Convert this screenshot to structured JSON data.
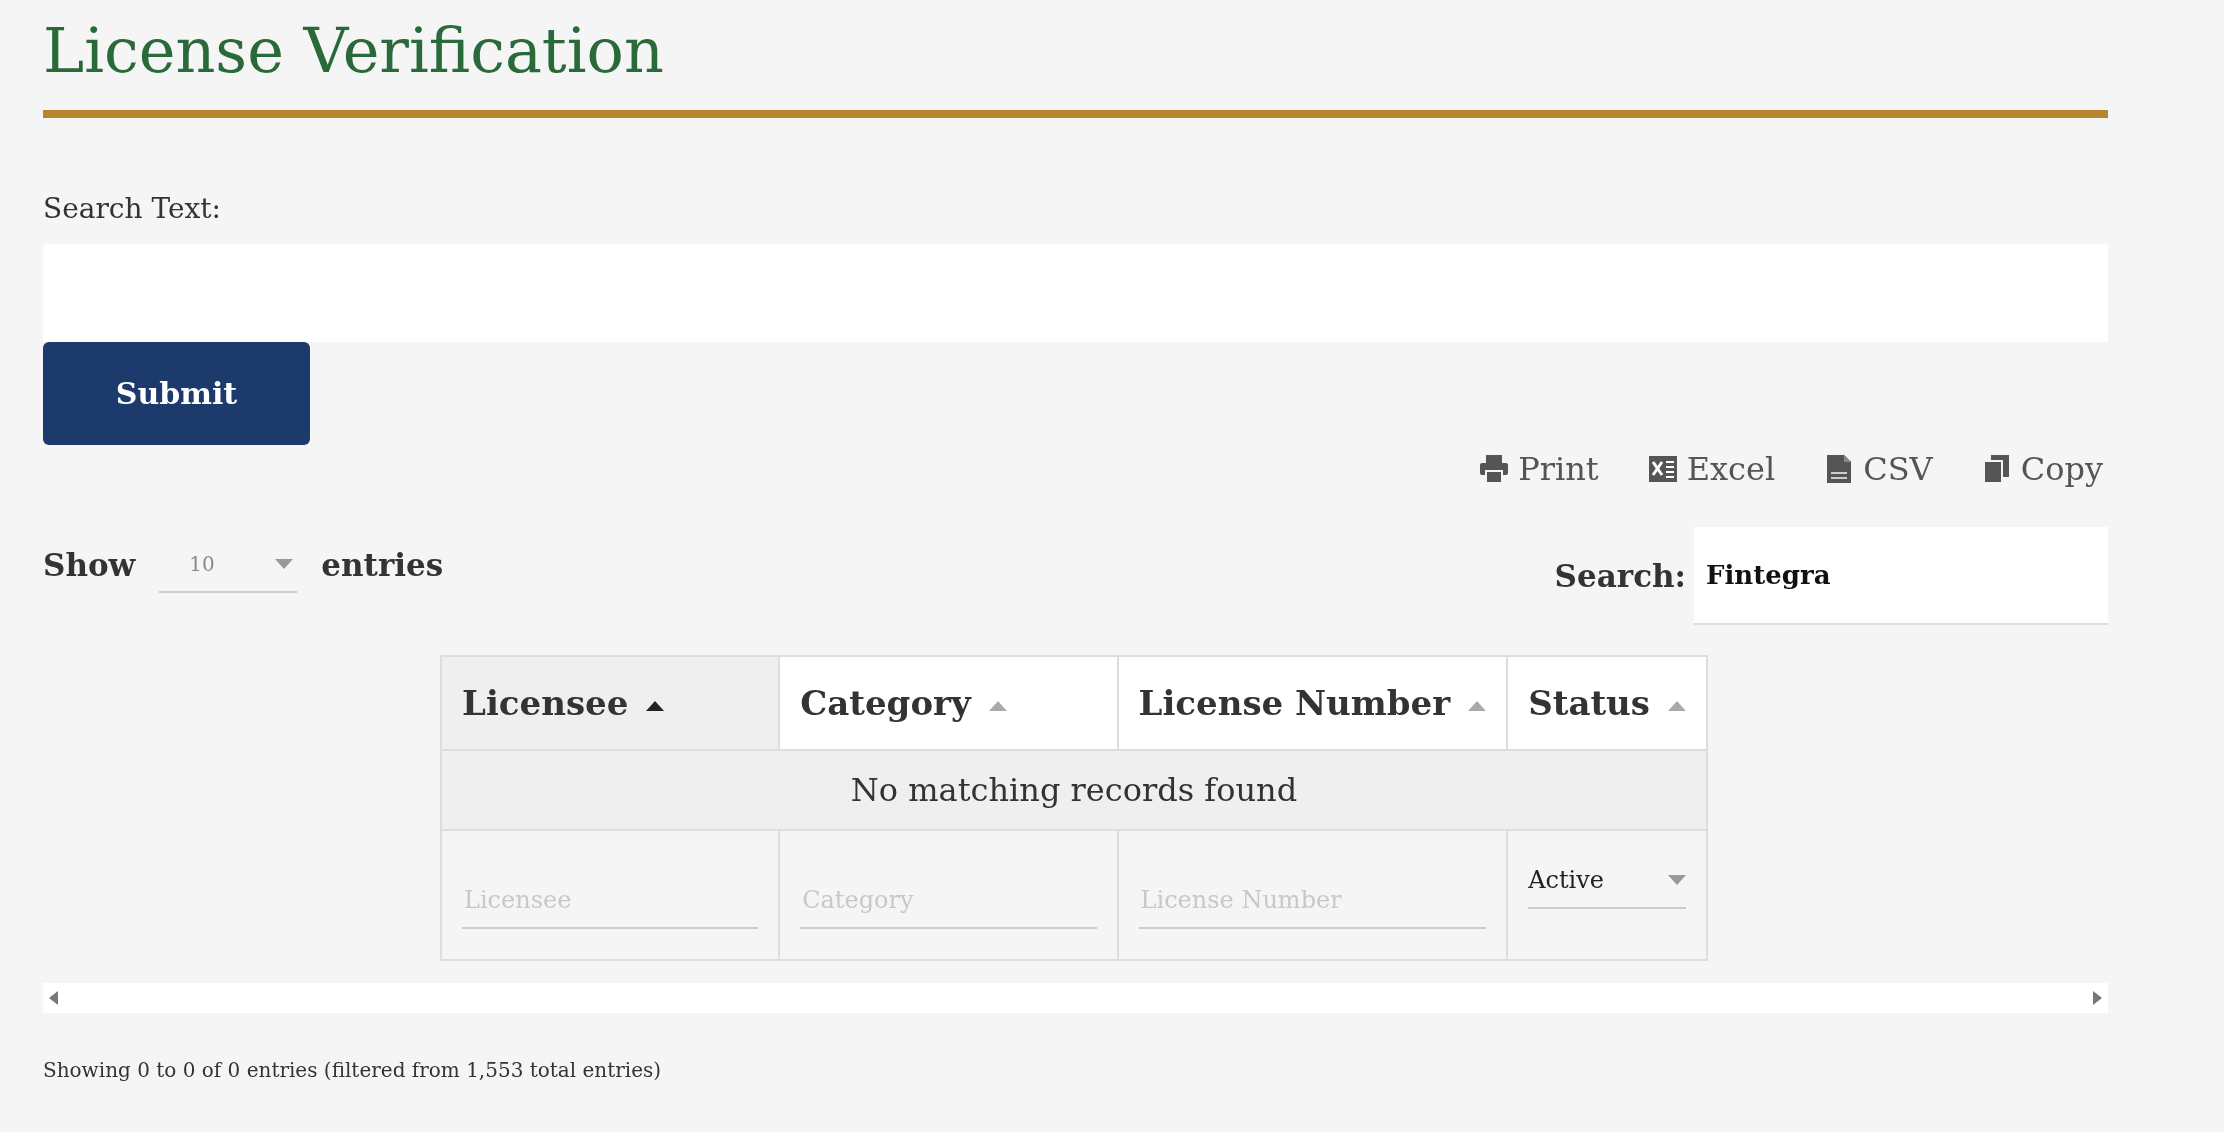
{
  "page": {
    "title": "License Verification"
  },
  "search_form": {
    "label": "Search Text:",
    "submit": "Submit"
  },
  "export_buttons": [
    {
      "kind": "print",
      "label": "Print"
    },
    {
      "kind": "excel",
      "label": "Excel"
    },
    {
      "kind": "csv",
      "label": "CSV"
    },
    {
      "kind": "copy",
      "label": "Copy"
    }
  ],
  "length_menu": {
    "prefix": "Show",
    "value": "10",
    "suffix": "entries"
  },
  "table_search": {
    "label": "Search:",
    "value": "Fintegra"
  },
  "table": {
    "columns": [
      {
        "label": "Licensee",
        "sorted": true
      },
      {
        "label": "Category",
        "sorted": false
      },
      {
        "label": "License Number",
        "sorted": false
      },
      {
        "label": "Status",
        "sorted": false
      }
    ],
    "empty_message": "No matching records found",
    "filters": [
      {
        "kind": "text",
        "placeholder": "Licensee"
      },
      {
        "kind": "text",
        "placeholder": "Category"
      },
      {
        "kind": "text",
        "placeholder": "License Number"
      },
      {
        "kind": "select",
        "value": "Active"
      }
    ]
  },
  "info": "Showing 0 to 0 of 0 entries (filtered from 1,553 total entries)"
}
